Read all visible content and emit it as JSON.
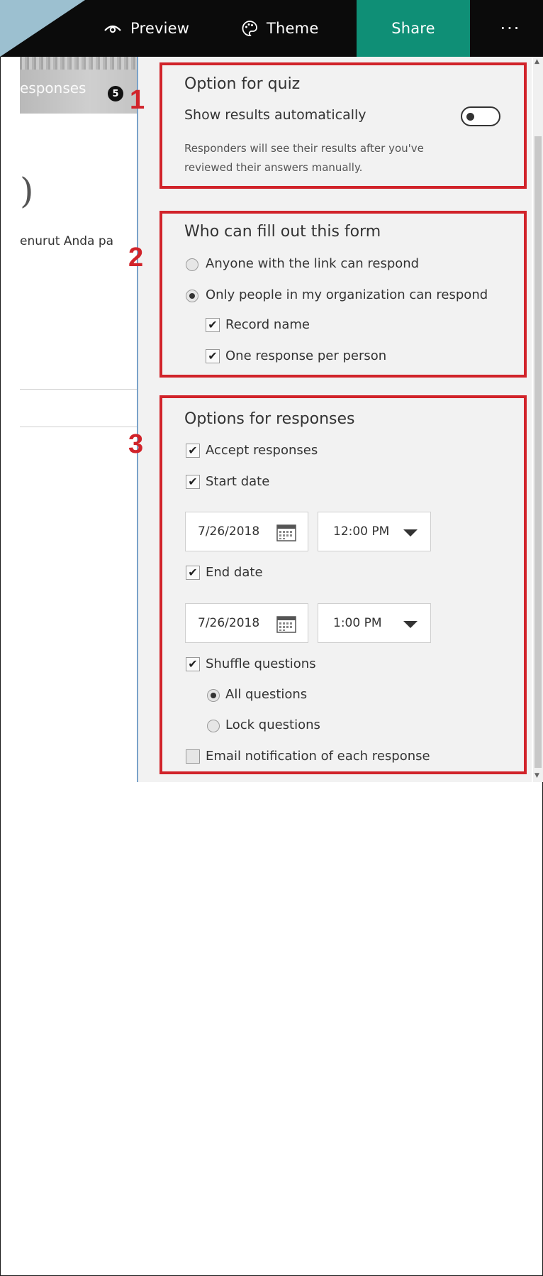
{
  "toolbar": {
    "preview_label": "Preview",
    "theme_label": "Theme",
    "share_label": "Share",
    "more_label": "···"
  },
  "editor": {
    "responses_tab": "esponses",
    "responses_count": "5",
    "paren": ")",
    "question_fragment": "enurut Anda pa"
  },
  "annotations": [
    "1",
    "2",
    "3"
  ],
  "quiz": {
    "title": "Option for quiz",
    "show_results_label": "Show results automatically",
    "show_results_on": false,
    "note_line1": "Responders will see their results after you've",
    "note_line2": "reviewed their answers manually."
  },
  "who": {
    "title": "Who can fill out this form",
    "anyone_label": "Anyone with the link can respond",
    "anyone_selected": false,
    "org_label": "Only people in my organization can respond",
    "org_selected": true,
    "record_name_label": "Record name",
    "record_name_checked": true,
    "one_response_label": "One response per person",
    "one_response_checked": true
  },
  "responses": {
    "title": "Options for responses",
    "accept_label": "Accept responses",
    "start_date_label": "Start date",
    "start_date": "7/26/2018",
    "start_time": "12:00 PM",
    "end_date_label": "End date",
    "end_date": "7/26/2018",
    "end_time": "1:00 PM",
    "shuffle_label": "Shuffle questions",
    "all_questions_label": "All questions",
    "lock_questions_label": "Lock questions",
    "email_label": "Email notification of each response",
    "email_checked": false
  },
  "colors": {
    "topbar": "#0b0b0b",
    "share": "#0f8f76",
    "annotation_red": "#d1232a",
    "panel": "#f2f2f2"
  },
  "icons": [
    "eye-icon",
    "palette-icon",
    "calendar-icon",
    "chevron-down-icon",
    "checkmark-icon"
  ]
}
